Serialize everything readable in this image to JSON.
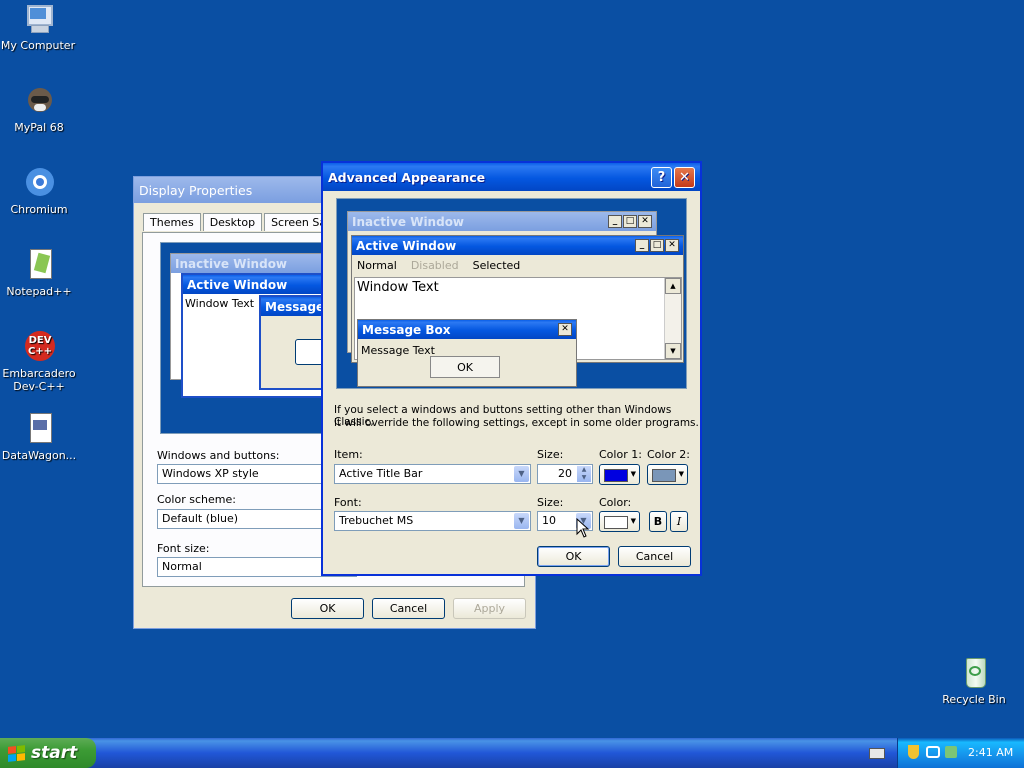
{
  "desktop": {
    "icons": [
      {
        "label": "My Computer"
      },
      {
        "label": "MyPal 68"
      },
      {
        "label": "Chromium"
      },
      {
        "label": "Notepad++"
      },
      {
        "label": "Embarcadero Dev-C++"
      },
      {
        "label": "DataWagon..."
      },
      {
        "label": "Recycle Bin"
      }
    ]
  },
  "display_properties": {
    "title": "Display Properties",
    "tabs": [
      "Themes",
      "Desktop",
      "Screen Saver"
    ],
    "preview": {
      "inactive": "Inactive Window",
      "active": "Active Window",
      "window_text": "Window Text",
      "message": "Message"
    },
    "windows_buttons_label": "Windows and buttons:",
    "windows_buttons_value": "Windows XP style",
    "color_scheme_label": "Color scheme:",
    "color_scheme_value": "Default (blue)",
    "font_size_label": "Font size:",
    "font_size_value": "Normal",
    "ok": "OK",
    "cancel": "Cancel",
    "apply": "Apply"
  },
  "advanced": {
    "title": "Advanced Appearance",
    "help_glyph": "?",
    "close_glyph": "✕",
    "preview": {
      "inactive": "Inactive Window",
      "active": "Active Window",
      "menu_normal": "Normal",
      "menu_disabled": "Disabled",
      "menu_selected": "Selected",
      "window_text": "Window Text",
      "message_box": "Message Box",
      "message_text": "Message Text",
      "ok": "OK"
    },
    "info_line1": "If you select a windows and buttons setting other than Windows Classic,",
    "info_line2": "it will override the following settings, except in some older programs.",
    "item_label": "Item:",
    "item_value": "Active Title Bar",
    "size_label": "Size:",
    "item_size": "20",
    "color1_label": "Color 1:",
    "color2_label": "Color 2:",
    "color1": "#0000e0",
    "color2": "#7a96b8",
    "font_label": "Font:",
    "font_value": "Trebuchet MS",
    "font_size_label": "Size:",
    "font_size": "10",
    "color_label": "Color:",
    "font_color": "#ffffff",
    "bold": "B",
    "italic": "I",
    "ok": "OK",
    "cancel": "Cancel"
  },
  "taskbar": {
    "start": "start",
    "clock": "2:41 AM"
  }
}
